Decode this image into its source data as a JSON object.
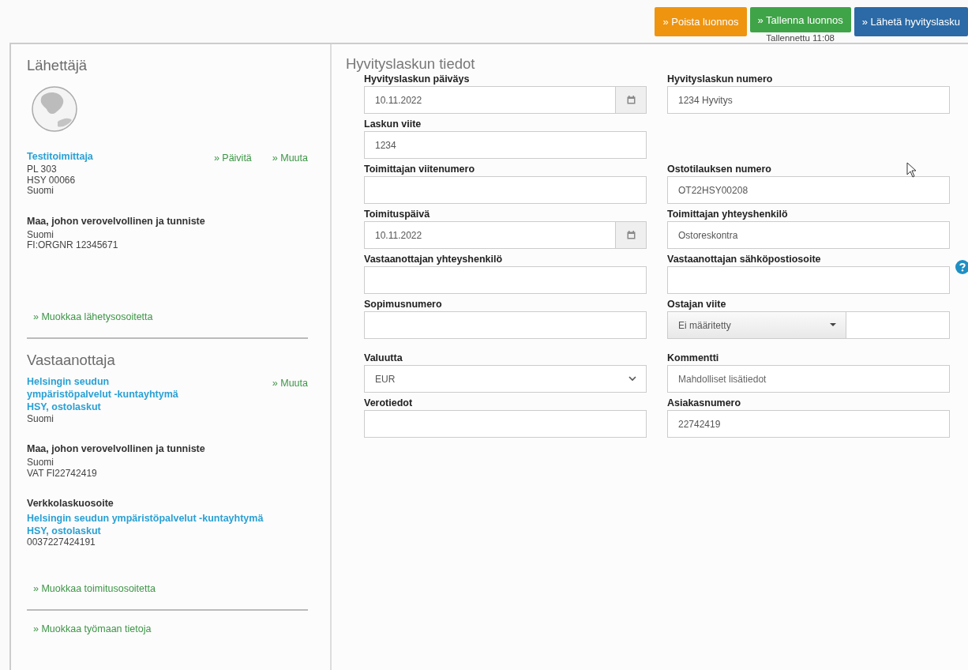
{
  "actions": [
    {
      "label": "» Poista luonnos",
      "color": "#ef940f"
    },
    {
      "label": "» Tallenna luonnos",
      "color": "#3fa447"
    },
    {
      "label": "» Lähetä hyvityslasku",
      "color": "#2b6aa6"
    }
  ],
  "saved_status": "Tallennettu 11:08",
  "sender": {
    "heading": "Lähettäjä",
    "name_lines": [
      "Testitoimittaja"
    ],
    "links": [
      "» Päivitä",
      "» Muuta"
    ],
    "address": [
      "PL 303",
      "HSY 00066",
      "Suomi"
    ],
    "tax_label": "Maa, johon verovelvollinen ja tunniste",
    "tax_lines": [
      "Suomi",
      "FI:ORGNR 12345671"
    ],
    "edit_link": "» Muokkaa lähetysosoitetta"
  },
  "recipient": {
    "heading": "Vastaanottaja",
    "name_lines": [
      "Helsingin seudun",
      "ympäristöpalvelut -kuntayhtymä",
      "HSY, ostolaskut"
    ],
    "links": [
      "» Muuta"
    ],
    "address": [
      "Suomi"
    ],
    "tax_label": "Maa, johon verovelvollinen ja tunniste",
    "tax_lines": [
      "Suomi",
      "VAT FI22742419"
    ],
    "einvoice_label": "Verkkolaskuosoite",
    "einvoice_name_lines": [
      "Helsingin seudun ympäristöpalvelut -kuntayhtymä",
      "HSY, ostolaskut"
    ],
    "einvoice_address": "0037227424191",
    "edit_link": "» Muokkaa toimitusosoitetta"
  },
  "site_link": "» Muokkaa työmaan tietoja",
  "form": {
    "heading": "Hyvityslaskun tiedot",
    "rows": [
      {
        "left": {
          "label": "Hyvityslaskun päiväys",
          "kind": "date",
          "value": "10.11.2022"
        },
        "right": {
          "label": "Hyvityslaskun numero",
          "kind": "text",
          "value": "1234 Hyvitys"
        }
      },
      {
        "left": {
          "label": "Laskun viite",
          "kind": "text",
          "value": "1234"
        }
      },
      {
        "left": {
          "label": "Toimittajan viitenumero",
          "kind": "text"
        },
        "right": {
          "label": "Ostotilauksen numero",
          "kind": "text",
          "value": "OT22HSY00208"
        }
      },
      {
        "left": {
          "label": "Toimituspäivä",
          "kind": "date",
          "value": "10.11.2022"
        },
        "right": {
          "label": "Toimittajan yhteyshenkilö",
          "kind": "text",
          "value": "Ostoreskontra"
        }
      },
      {
        "left": {
          "label": "Vastaanottajan yhteyshenkilö",
          "kind": "text"
        },
        "right": {
          "label": "Vastaanottajan sähköpostiosoite",
          "kind": "help-text"
        }
      },
      {
        "left": {
          "label": "Sopimusnumero",
          "kind": "text"
        },
        "right": {
          "label": "Ostajan viite",
          "kind": "split-select",
          "value": "Ei määritetty"
        }
      },
      {
        "left": {
          "label": "Valuutta",
          "kind": "select",
          "value": "EUR"
        },
        "right": {
          "label": "Kommentti",
          "kind": "text",
          "placeholder": "Mahdolliset lisätiedot"
        }
      },
      {
        "left": {
          "label": "Verotiedot",
          "kind": "text"
        },
        "right": {
          "label": "Asiakasnumero",
          "kind": "text",
          "value": "22742419"
        }
      }
    ]
  }
}
